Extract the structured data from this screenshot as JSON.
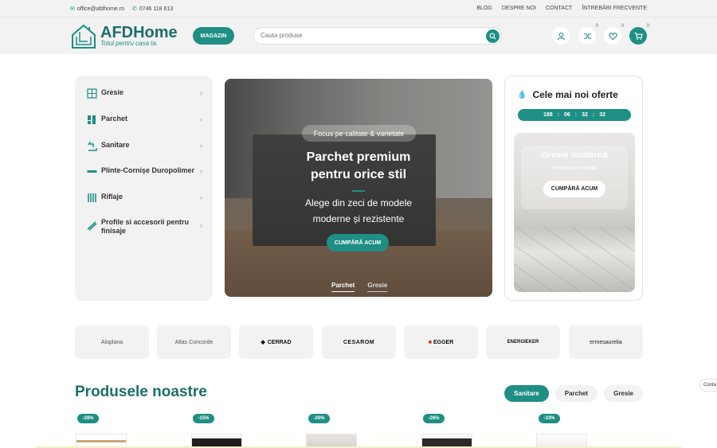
{
  "topbar": {
    "email": "office@afdhome.ro",
    "phone": "0746 118 613",
    "links": [
      "BLOG",
      "DESPRE NOI",
      "CONTACT",
      "ÎNTREBĂRI FRECVENTE"
    ]
  },
  "header": {
    "logo_name": "AFDHome",
    "logo_tagline": "Totul pentru casa ta.",
    "shop_button": "MAGAZIN",
    "search_placeholder": "Cauta produse",
    "compare_count": "0",
    "wishlist_count": "0",
    "cart_count": "0"
  },
  "categories": [
    {
      "label": "Gresie",
      "icon": "tiles-icon"
    },
    {
      "label": "Parchet",
      "icon": "parquet-icon"
    },
    {
      "label": "Sanitare",
      "icon": "faucet-icon"
    },
    {
      "label": "Plinte-Cornișe Duropolimer",
      "icon": "molding-icon"
    },
    {
      "label": "Riflaje",
      "icon": "slats-icon"
    },
    {
      "label": "Profile si accesorii pentru finisaje",
      "icon": "profile-icon"
    }
  ],
  "hero": {
    "pill": "Focus pe calitate & varietate",
    "title": "Parchet premium pentru orice stil",
    "subtitle": "Alege din zeci de modele moderne și rezistente",
    "button": "CUMPĂRĂ ACUM",
    "tabs": [
      "Parchet",
      "Gresie"
    ]
  },
  "offers": {
    "title": "Cele mai noi oferte",
    "timer": [
      "188",
      "06",
      "32",
      "32"
    ],
    "promo_title": "Gresie modernă",
    "promo_subtitle": "Pentru orice spațiu",
    "promo_button": "CUMPĂRĂ ACUM"
  },
  "brands": [
    "Aloplana",
    "Atlas Concorde",
    "CERRAD",
    "CESAROM",
    "EGGER",
    "ENERGIEKER",
    "ermesaurelia"
  ],
  "products": {
    "title": "Produsele noastre",
    "tabs": [
      "Sanitare",
      "Parchet",
      "Gresie"
    ],
    "discounts": [
      "-28%",
      "-15%",
      "-26%",
      "-26%",
      "-33%"
    ]
  },
  "contact_tab": "Conta",
  "colors": {
    "accent": "#1f8f85",
    "accent_dark": "#1c6f69",
    "panel": "#f2f2f2"
  }
}
